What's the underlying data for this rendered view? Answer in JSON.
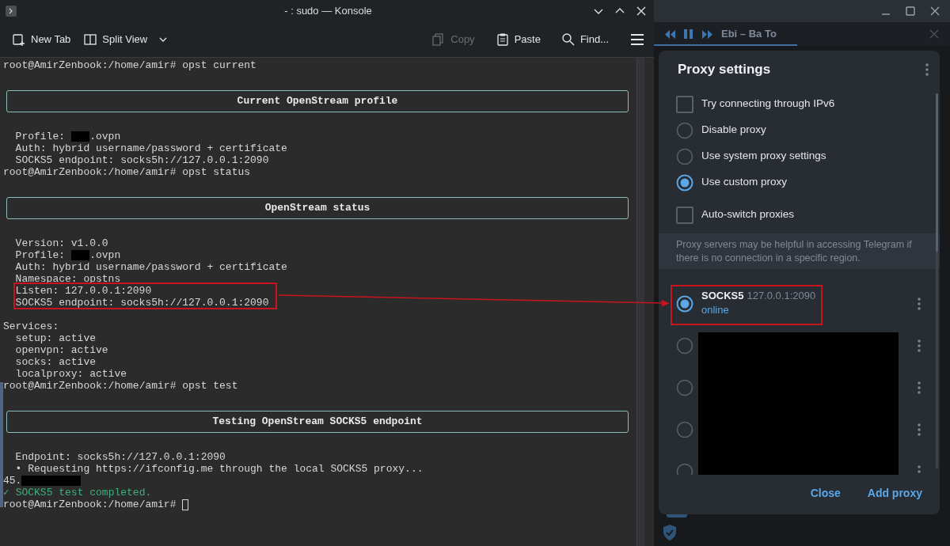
{
  "konsole": {
    "title": "- : sudo — Konsole",
    "toolbar": [
      {
        "kind": "new-tab",
        "label": "New Tab",
        "disabled": false
      },
      {
        "kind": "split-view",
        "label": "Split View",
        "disabled": false
      },
      {
        "kind": "copy",
        "label": "Copy",
        "disabled": true
      },
      {
        "kind": "paste",
        "label": "Paste",
        "disabled": false
      },
      {
        "kind": "find",
        "label": "Find...",
        "disabled": false
      }
    ],
    "terminal": [
      {
        "kind": "prompt",
        "text": "root@AmirZenbook:/home/amir# opst current"
      },
      {
        "kind": "banner",
        "text": "Current OpenStream profile"
      },
      {
        "kind": "masked-short",
        "parts": [
          "Profile:",
          ".ovpn"
        ]
      },
      {
        "kind": "output",
        "text": "Auth: hybrid username/password + certificate"
      },
      {
        "kind": "output",
        "text": "SOCKS5 endpoint: socks5h://127.0.0.1:2090"
      },
      {
        "kind": "prompt",
        "text": "root@AmirZenbook:/home/amir# opst status"
      },
      {
        "kind": "banner",
        "text": "OpenStream status"
      },
      {
        "kind": "output",
        "text": "Version: v1.0.0"
      },
      {
        "kind": "masked-short",
        "parts": [
          "Profile:",
          ".ovpn"
        ]
      },
      {
        "kind": "output",
        "text": "Auth: hybrid username/password + certificate"
      },
      {
        "kind": "output",
        "text": "Namespace: opstns"
      },
      {
        "kind": "output",
        "text": "Listen: 127.0.0.1:2090"
      },
      {
        "kind": "output",
        "text": "SOCKS5 endpoint: socks5h://127.0.0.1:2090"
      },
      {
        "kind": "heading",
        "text": "Services:"
      },
      {
        "kind": "output",
        "text": "setup: active"
      },
      {
        "kind": "output",
        "text": "openvpn: active"
      },
      {
        "kind": "output",
        "text": "socks: active"
      },
      {
        "kind": "output",
        "text": "localproxy: active"
      },
      {
        "kind": "prompt",
        "text": "root@AmirZenbook:/home/amir# opst test"
      },
      {
        "kind": "banner",
        "text": "Testing OpenStream SOCKS5 endpoint"
      },
      {
        "kind": "output",
        "text": "Endpoint: socks5h://127.0.0.1:2090"
      },
      {
        "kind": "output",
        "text": "• Requesting https://ifconfig.me through the local SOCKS5 proxy..."
      },
      {
        "kind": "masked-long",
        "parts": [
          "45."
        ]
      },
      {
        "kind": "success",
        "text": "✓ SOCKS5 test completed."
      },
      {
        "kind": "cursor",
        "text": "root@AmirZenbook:/home/amir#"
      }
    ]
  },
  "telegram": {
    "player": {
      "track": "Ebi – Ba To"
    },
    "dialog": {
      "title": "Proxy settings",
      "options": [
        {
          "kind": "checkbox",
          "label": "Try connecting through IPv6",
          "checked": false
        },
        {
          "kind": "radio",
          "label": "Disable proxy",
          "selected": false
        },
        {
          "kind": "radio",
          "label": "Use system proxy settings",
          "selected": false
        },
        {
          "kind": "radio",
          "label": "Use custom proxy",
          "selected": true
        },
        {
          "kind": "checkbox",
          "label": "Auto-switch proxies",
          "checked": false
        }
      ],
      "note": "Proxy servers may be helpful in accessing Telegram if there is no connection in a specific region.",
      "proxies": [
        {
          "selected": true,
          "type": "SOCKS5",
          "address": "127.0.0.1:2090",
          "status": "online"
        },
        {
          "selected": false
        },
        {
          "selected": false
        },
        {
          "selected": false
        },
        {
          "selected": false
        }
      ],
      "buttons": [
        "Close",
        "Add proxy"
      ]
    }
  }
}
